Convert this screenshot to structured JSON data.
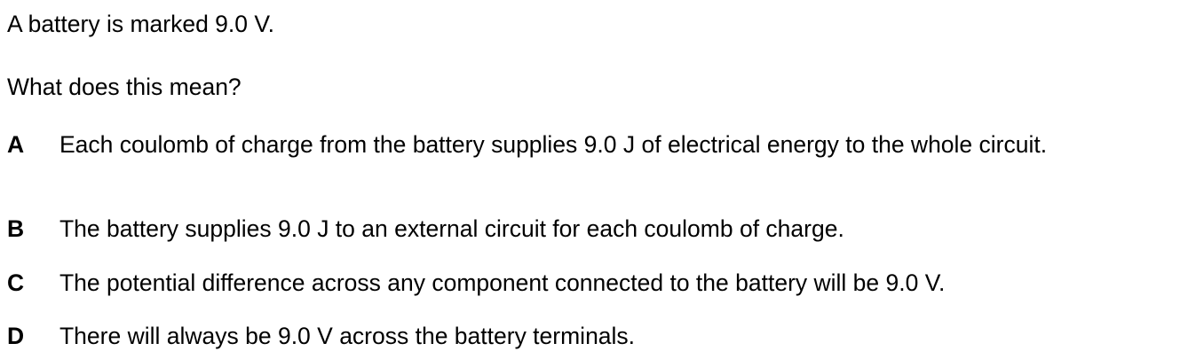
{
  "question": {
    "stem_line1": "A battery is marked 9.0 V.",
    "stem_line2": "What does this mean?"
  },
  "options": [
    {
      "letter": "A",
      "text": "Each coulomb of charge from the battery supplies 9.0 J of electrical energy to the whole circuit."
    },
    {
      "letter": "B",
      "text": "The battery supplies 9.0 J to an external circuit for each coulomb of charge."
    },
    {
      "letter": "C",
      "text": "The potential difference across any component connected to the battery will be 9.0 V."
    },
    {
      "letter": "D",
      "text": "There will always be 9.0 V across the battery terminals."
    }
  ]
}
